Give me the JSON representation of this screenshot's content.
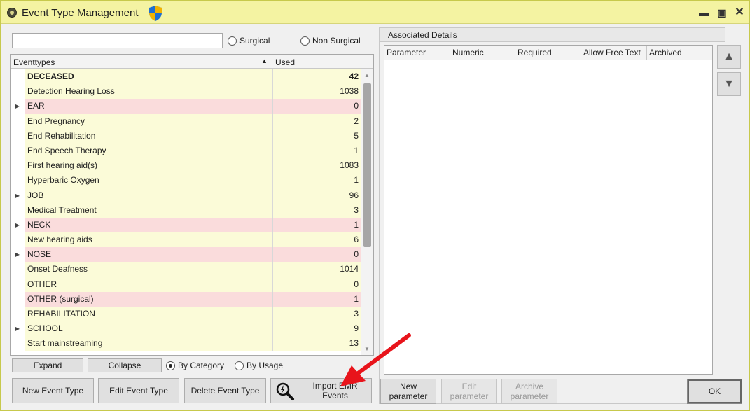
{
  "window": {
    "title": "Event Type Management"
  },
  "filters": {
    "search_value": "",
    "surgical_label": "Surgical",
    "non_surgical_label": "Non Surgical"
  },
  "event_grid": {
    "columns": {
      "name": "Eventtypes",
      "used": "Used"
    },
    "rows": [
      {
        "name": "DECEASED",
        "used": "42",
        "expandable": false,
        "style": "yellow",
        "bold": true
      },
      {
        "name": "Detection Hearing Loss",
        "used": "1038",
        "expandable": false,
        "style": "yellow",
        "bold": false
      },
      {
        "name": "EAR",
        "used": "0",
        "expandable": true,
        "style": "pink",
        "bold": false
      },
      {
        "name": "End Pregnancy",
        "used": "2",
        "expandable": false,
        "style": "yellow",
        "bold": false
      },
      {
        "name": "End Rehabilitation",
        "used": "5",
        "expandable": false,
        "style": "yellow",
        "bold": false
      },
      {
        "name": "End Speech Therapy",
        "used": "1",
        "expandable": false,
        "style": "yellow",
        "bold": false
      },
      {
        "name": "First hearing aid(s)",
        "used": "1083",
        "expandable": false,
        "style": "yellow",
        "bold": false
      },
      {
        "name": "Hyperbaric Oxygen",
        "used": "1",
        "expandable": false,
        "style": "yellow",
        "bold": false
      },
      {
        "name": "JOB",
        "used": "96",
        "expandable": true,
        "style": "yellow",
        "bold": false
      },
      {
        "name": "Medical Treatment",
        "used": "3",
        "expandable": false,
        "style": "yellow",
        "bold": false
      },
      {
        "name": "NECK",
        "used": "1",
        "expandable": true,
        "style": "pink",
        "bold": false
      },
      {
        "name": "New hearing aids",
        "used": "6",
        "expandable": false,
        "style": "yellow",
        "bold": false
      },
      {
        "name": "NOSE",
        "used": "0",
        "expandable": true,
        "style": "pink",
        "bold": false
      },
      {
        "name": "Onset Deafness",
        "used": "1014",
        "expandable": false,
        "style": "yellow",
        "bold": false
      },
      {
        "name": "OTHER",
        "used": "0",
        "expandable": false,
        "style": "yellow",
        "bold": false
      },
      {
        "name": "OTHER (surgical)",
        "used": "1",
        "expandable": false,
        "style": "pink",
        "bold": false
      },
      {
        "name": "REHABILITATION",
        "used": "3",
        "expandable": false,
        "style": "yellow",
        "bold": false
      },
      {
        "name": "SCHOOL",
        "used": "9",
        "expandable": true,
        "style": "yellow",
        "bold": false
      },
      {
        "name": "Start mainstreaming",
        "used": "13",
        "expandable": false,
        "style": "yellow",
        "bold": false
      }
    ]
  },
  "tree_controls": {
    "expand_label": "Expand",
    "collapse_label": "Collapse",
    "by_category_label": "By Category",
    "by_usage_label": "By Usage"
  },
  "actions": {
    "new_event_type": "New Event Type",
    "edit_event_type": "Edit Event Type",
    "delete_event_type": "Delete Event Type",
    "import_emr_events": "Import EMR Events"
  },
  "details": {
    "title": "Associated Details",
    "columns": [
      "Parameter",
      "Numeric",
      "Required",
      "Allow Free Text",
      "Archived"
    ],
    "new_parameter": "New parameter",
    "edit_parameter": "Edit parameter",
    "archive_parameter": "Archive parameter",
    "ok": "OK"
  },
  "colors": {
    "titlebar": "#f4f3a2",
    "row_yellow": "#fbfbd8",
    "row_pink": "#fadcdc",
    "annotation_arrow": "#e8141b"
  }
}
